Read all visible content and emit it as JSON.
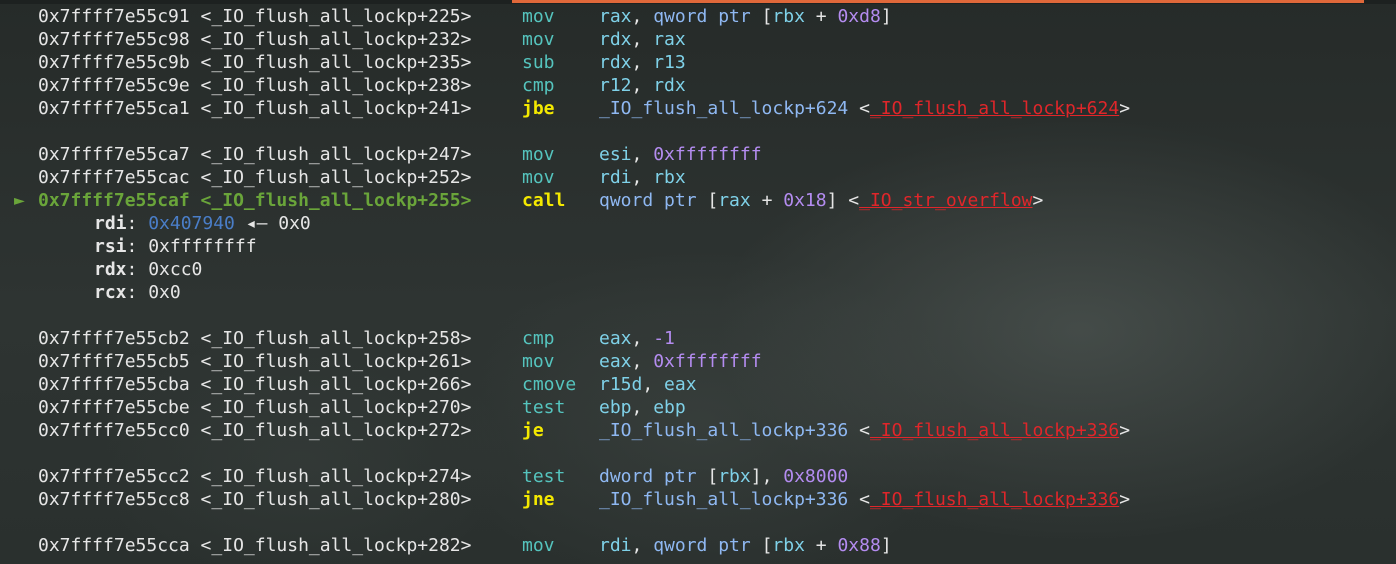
{
  "window": {
    "accent_color": "#e0683a"
  },
  "current_marker": "►",
  "disassembly": [
    {
      "addr": "0x7ffff7e55c91 <_IO_flush_all_lockp+225>",
      "mnemonic": "mov",
      "operands": [
        [
          "rax",
          "reg"
        ],
        [
          ", ",
          "plain"
        ],
        [
          "qword ptr ",
          "kw"
        ],
        [
          "[",
          "plain"
        ],
        [
          "rbx",
          "reg"
        ],
        [
          " + ",
          "plain"
        ],
        [
          "0xd8",
          "num"
        ],
        [
          "]",
          "plain"
        ]
      ]
    },
    {
      "addr": "0x7ffff7e55c98 <_IO_flush_all_lockp+232>",
      "mnemonic": "mov",
      "operands": [
        [
          "rdx",
          "reg"
        ],
        [
          ", ",
          "plain"
        ],
        [
          "rax",
          "reg"
        ]
      ]
    },
    {
      "addr": "0x7ffff7e55c9b <_IO_flush_all_lockp+235>",
      "mnemonic": "sub",
      "operands": [
        [
          "rdx",
          "reg"
        ],
        [
          ", ",
          "plain"
        ],
        [
          "r13",
          "reg"
        ]
      ]
    },
    {
      "addr": "0x7ffff7e55c9e <_IO_flush_all_lockp+238>",
      "mnemonic": "cmp",
      "operands": [
        [
          "r12",
          "reg"
        ],
        [
          ", ",
          "plain"
        ],
        [
          "rdx",
          "reg"
        ]
      ]
    },
    {
      "addr": "0x7ffff7e55ca1 <_IO_flush_all_lockp+241>",
      "mnemonic": "jbe",
      "jump": true,
      "operands": [
        [
          "_IO_flush_all_lockp+624",
          "sym"
        ],
        [
          " <",
          "plain"
        ],
        [
          "_IO_flush_all_lockp+624",
          "dest"
        ],
        [
          ">",
          "plain"
        ]
      ]
    },
    {
      "blank": true
    },
    {
      "addr": "0x7ffff7e55ca7 <_IO_flush_all_lockp+247>",
      "mnemonic": "mov",
      "operands": [
        [
          "esi",
          "reg"
        ],
        [
          ", ",
          "plain"
        ],
        [
          "0xffffffff",
          "num"
        ]
      ]
    },
    {
      "addr": "0x7ffff7e55cac <_IO_flush_all_lockp+252>",
      "mnemonic": "mov",
      "operands": [
        [
          "rdi",
          "reg"
        ],
        [
          ", ",
          "plain"
        ],
        [
          "rbx",
          "reg"
        ]
      ]
    },
    {
      "addr": "0x7ffff7e55caf <_IO_flush_all_lockp+255>",
      "mnemonic": "call",
      "current": true,
      "operands": [
        [
          "qword ptr ",
          "kw"
        ],
        [
          "[",
          "plain"
        ],
        [
          "rax",
          "reg"
        ],
        [
          " + ",
          "plain"
        ],
        [
          "0x18",
          "num"
        ],
        [
          "] <",
          "plain"
        ],
        [
          "_IO_str_overflow",
          "dest"
        ],
        [
          ">",
          "plain"
        ]
      ]
    },
    {
      "arg": true,
      "name": "rdi",
      "value": [
        [
          "0x407940",
          "addr-blue"
        ],
        [
          " ◂— 0x0",
          "plain"
        ]
      ]
    },
    {
      "arg": true,
      "name": "rsi",
      "value": [
        [
          "0xffffffff",
          "plain"
        ]
      ]
    },
    {
      "arg": true,
      "name": "rdx",
      "value": [
        [
          "0xcc0",
          "plain"
        ]
      ]
    },
    {
      "arg": true,
      "name": "rcx",
      "value": [
        [
          "0x0",
          "plain"
        ]
      ]
    },
    {
      "blank": true
    },
    {
      "addr": "0x7ffff7e55cb2 <_IO_flush_all_lockp+258>",
      "mnemonic": "cmp",
      "operands": [
        [
          "eax",
          "reg"
        ],
        [
          ", ",
          "plain"
        ],
        [
          "-1",
          "num"
        ]
      ]
    },
    {
      "addr": "0x7ffff7e55cb5 <_IO_flush_all_lockp+261>",
      "mnemonic": "mov",
      "operands": [
        [
          "eax",
          "reg"
        ],
        [
          ", ",
          "plain"
        ],
        [
          "0xffffffff",
          "num"
        ]
      ]
    },
    {
      "addr": "0x7ffff7e55cba <_IO_flush_all_lockp+266>",
      "mnemonic": "cmove",
      "operands": [
        [
          "r15d",
          "reg"
        ],
        [
          ", ",
          "plain"
        ],
        [
          "eax",
          "reg"
        ]
      ]
    },
    {
      "addr": "0x7ffff7e55cbe <_IO_flush_all_lockp+270>",
      "mnemonic": "test",
      "operands": [
        [
          "ebp",
          "reg"
        ],
        [
          ", ",
          "plain"
        ],
        [
          "ebp",
          "reg"
        ]
      ]
    },
    {
      "addr": "0x7ffff7e55cc0 <_IO_flush_all_lockp+272>",
      "mnemonic": "je",
      "jump": true,
      "operands": [
        [
          "_IO_flush_all_lockp+336",
          "sym"
        ],
        [
          " <",
          "plain"
        ],
        [
          "_IO_flush_all_lockp+336",
          "dest"
        ],
        [
          ">",
          "plain"
        ]
      ]
    },
    {
      "blank": true
    },
    {
      "addr": "0x7ffff7e55cc2 <_IO_flush_all_lockp+274>",
      "mnemonic": "test",
      "operands": [
        [
          "dword ptr ",
          "kw"
        ],
        [
          "[",
          "plain"
        ],
        [
          "rbx",
          "reg"
        ],
        [
          "], ",
          "plain"
        ],
        [
          "0x8000",
          "num"
        ]
      ]
    },
    {
      "addr": "0x7ffff7e55cc8 <_IO_flush_all_lockp+280>",
      "mnemonic": "jne",
      "jump": true,
      "operands": [
        [
          "_IO_flush_all_lockp+336",
          "sym"
        ],
        [
          " <",
          "plain"
        ],
        [
          "_IO_flush_all_lockp+336",
          "dest"
        ],
        [
          ">",
          "plain"
        ]
      ]
    },
    {
      "blank": true
    },
    {
      "addr": "0x7ffff7e55cca <_IO_flush_all_lockp+282>",
      "mnemonic": "mov",
      "operands": [
        [
          "rdi",
          "reg"
        ],
        [
          ", ",
          "plain"
        ],
        [
          "qword ptr ",
          "kw"
        ],
        [
          "[",
          "plain"
        ],
        [
          "rbx",
          "reg"
        ],
        [
          " + ",
          "plain"
        ],
        [
          "0x88",
          "num"
        ],
        [
          "]",
          "plain"
        ]
      ]
    }
  ]
}
